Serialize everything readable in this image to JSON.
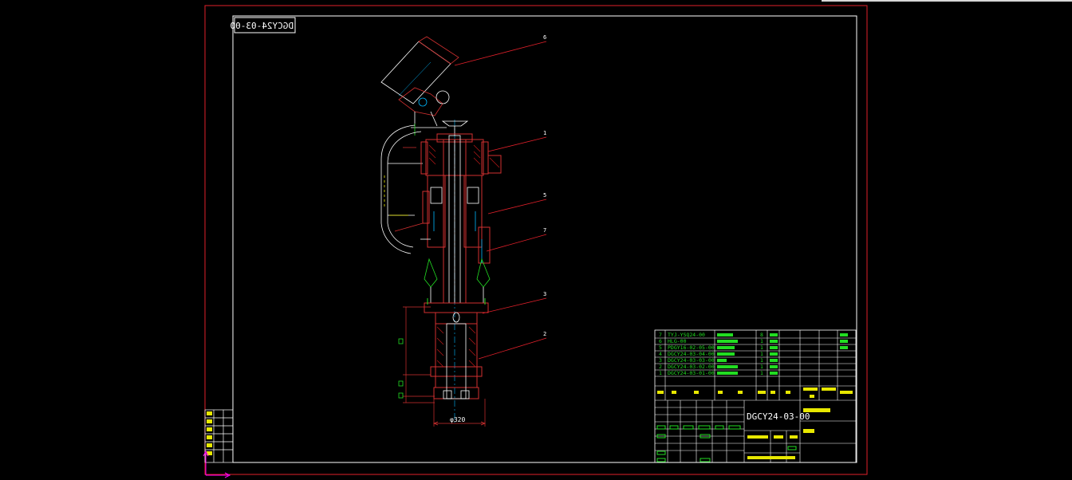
{
  "drawing": {
    "mirrored_code": "DGCY24-03-00",
    "callouts": [
      "6",
      "1",
      "5",
      "7",
      "3",
      "2"
    ],
    "dimension": "φ320",
    "colors": {
      "background": "#000000",
      "sheet_border": "#e0202a",
      "frame": "#ffffff",
      "part": "#d23030",
      "hatch": "#b01818",
      "axis": "#00b8ff",
      "leader": "#e0202a",
      "accent_green": "#22dd22",
      "ucs_icon": "#ff00ff"
    }
  },
  "bom": {
    "rows": [
      {
        "no": "7",
        "code": "TYJ-YSQ24-00"
      },
      {
        "no": "6",
        "code": "HLG-00"
      },
      {
        "no": "5",
        "code": "PDGY16-02-05-00"
      },
      {
        "no": "4",
        "code": "DGCY24-03-04-00"
      },
      {
        "no": "3",
        "code": "DGCY24-03-03-00"
      },
      {
        "no": "2",
        "code": "DGCY24-03-02-00"
      },
      {
        "no": "1",
        "code": "DGCY24-03-01-00"
      }
    ],
    "qty": [
      "8",
      "1",
      "1",
      "1",
      "1",
      "1",
      "1"
    ]
  },
  "title_block": {
    "drawing_no": "DGCY24-03-00"
  }
}
